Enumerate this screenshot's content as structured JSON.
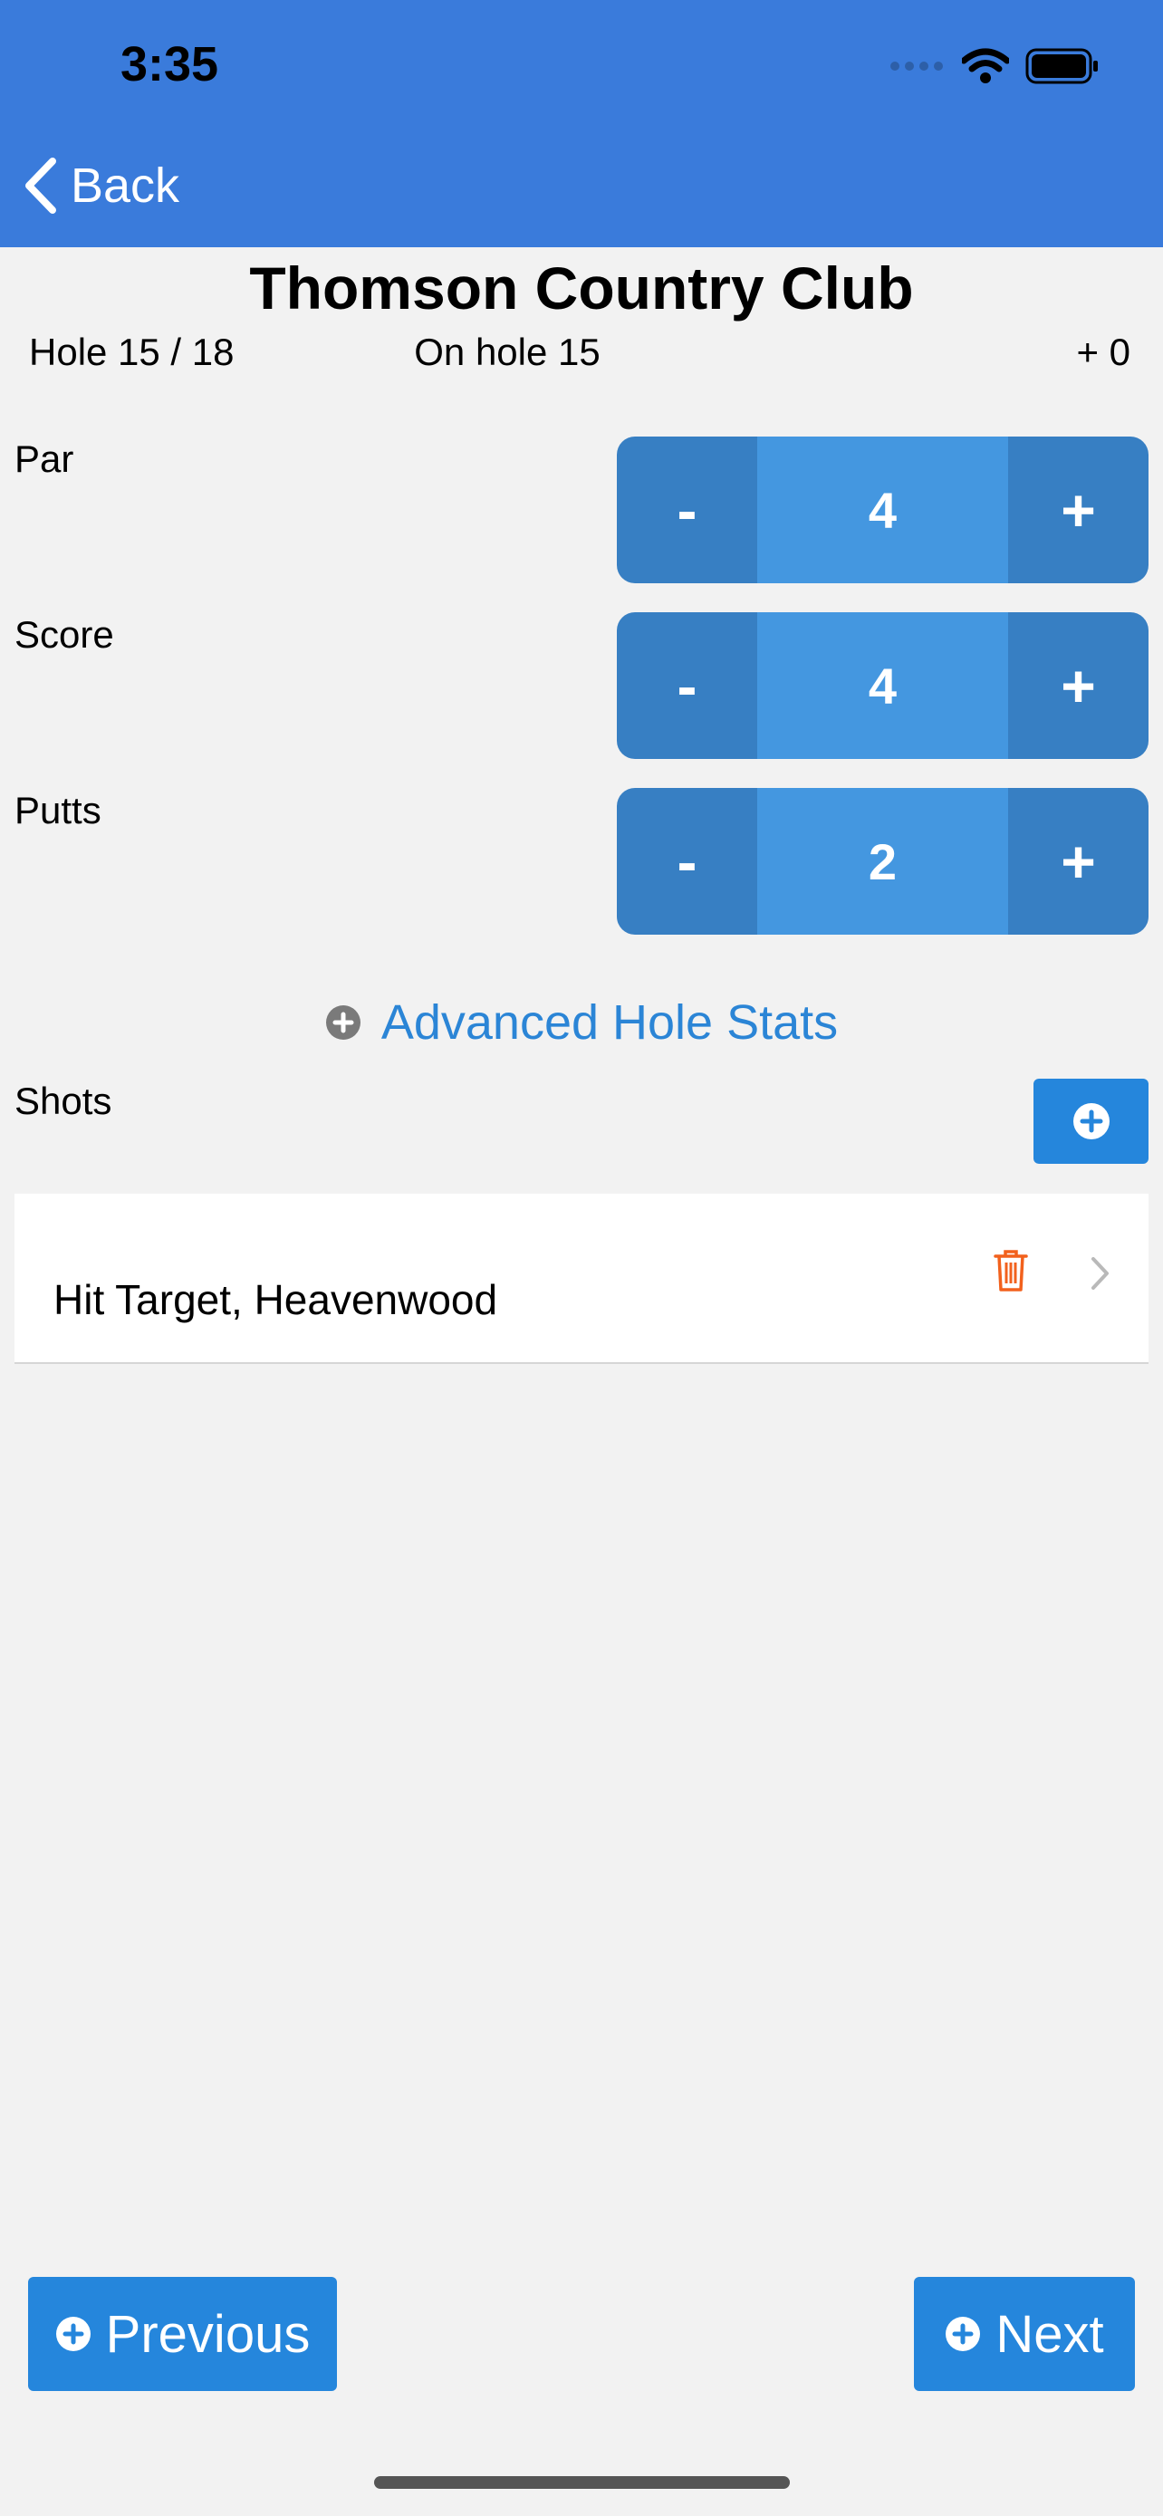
{
  "status_bar": {
    "time": "3:35",
    "icons": [
      "signal-icon",
      "wifi-icon",
      "battery-icon"
    ]
  },
  "nav": {
    "back_label": "Back"
  },
  "header": {
    "course": "Thomson Country Club",
    "hole_progress": "Hole 15 / 18",
    "current_hole": "On hole 15",
    "score_to_par": "+ 0"
  },
  "steppers": {
    "par": {
      "label": "Par",
      "value": "4",
      "minus": "-",
      "plus": "+"
    },
    "score": {
      "label": "Score",
      "value": "4",
      "minus": "-",
      "plus": "+"
    },
    "putts": {
      "label": "Putts",
      "value": "2",
      "minus": "-",
      "plus": "+"
    }
  },
  "advanced": {
    "label": "Advanced Hole Stats"
  },
  "shots": {
    "label": "Shots",
    "items": [
      {
        "text": "Hit Target, Heavenwood"
      }
    ]
  },
  "footer": {
    "previous_label": "Previous",
    "next_label": "Next"
  },
  "colors": {
    "header_bg": "#3a7bdb",
    "stepper_btn": "#377fc3",
    "stepper_val": "#4497e0",
    "accent": "#2586dc",
    "delete": "#f2611d"
  }
}
